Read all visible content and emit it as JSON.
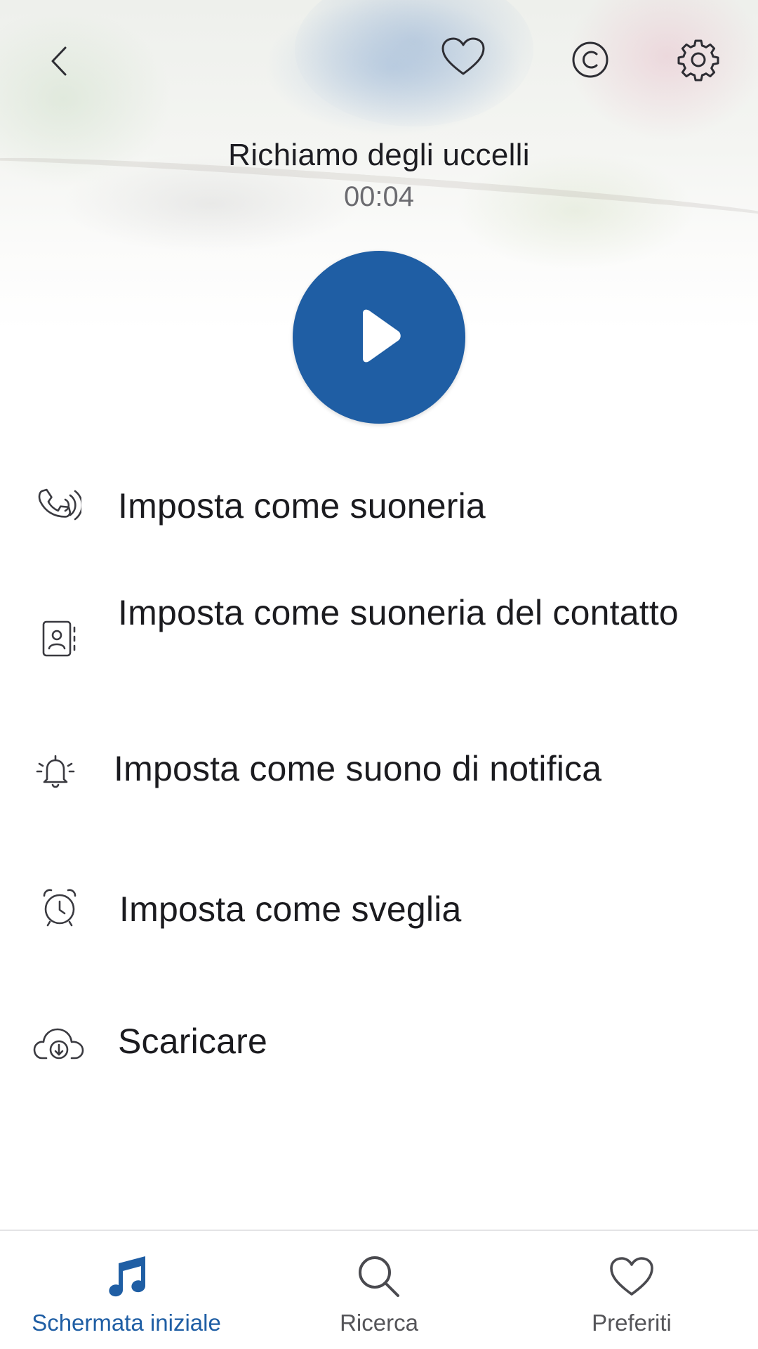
{
  "header": {
    "back_icon": "chevron-left-icon",
    "favorite_icon": "heart-outline-icon",
    "copyright_icon": "copyright-icon",
    "settings_icon": "gear-icon"
  },
  "track": {
    "title": "Richiamo degli uccelli",
    "duration": "00:04"
  },
  "player": {
    "play_icon": "play-icon",
    "accent_color": "#1f5ea4"
  },
  "menu": {
    "items": [
      {
        "label": "Imposta come suoneria",
        "icon": "phone-ringing-icon"
      },
      {
        "label": "Imposta come suoneria del contatto",
        "icon": "contact-card-icon"
      },
      {
        "label": "Imposta come suono di notifica",
        "icon": "bell-ringing-icon"
      },
      {
        "label": "Imposta come sveglia",
        "icon": "alarm-clock-icon"
      },
      {
        "label": "Scaricare",
        "icon": "cloud-download-icon"
      }
    ]
  },
  "bottom_nav": {
    "items": [
      {
        "label": "Schermata iniziale",
        "icon": "music-note-icon",
        "active": true
      },
      {
        "label": "Ricerca",
        "icon": "search-icon",
        "active": false
      },
      {
        "label": "Preferiti",
        "icon": "heart-outline-icon",
        "active": false
      }
    ]
  }
}
